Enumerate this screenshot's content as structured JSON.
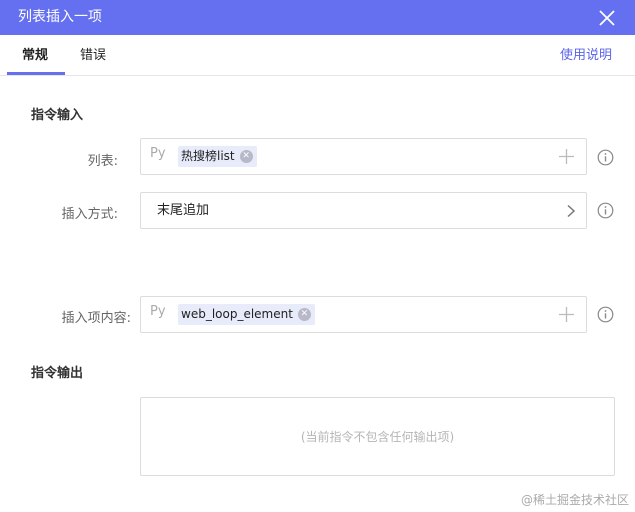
{
  "dialog": {
    "title": "列表插入一项"
  },
  "tabs": [
    {
      "label": "常规",
      "active": true
    },
    {
      "label": "错误",
      "active": false
    }
  ],
  "help_link": "使用说明",
  "input_section": {
    "title": "指令输入",
    "list_field": {
      "label": "列表:",
      "prefix": "Py",
      "value_chip": "热搜榜list"
    },
    "insert_mode_field": {
      "label": "插入方式:",
      "value": "末尾追加"
    },
    "item_content_field": {
      "label": "插入项内容:",
      "prefix": "Py",
      "value_chip": "web_loop_element"
    }
  },
  "output_section": {
    "title": "指令输出",
    "empty_text": "(当前指令不包含任何输出项)"
  },
  "watermark": "@稀土掘金技术社区",
  "colors": {
    "accent": "#6470f0",
    "link": "#5a64e8",
    "chip_bg": "#e8ebfa"
  },
  "icons": {
    "close": "close-icon",
    "add": "plus-icon",
    "info": "info-icon",
    "dropdown": "chevron-right-icon"
  }
}
